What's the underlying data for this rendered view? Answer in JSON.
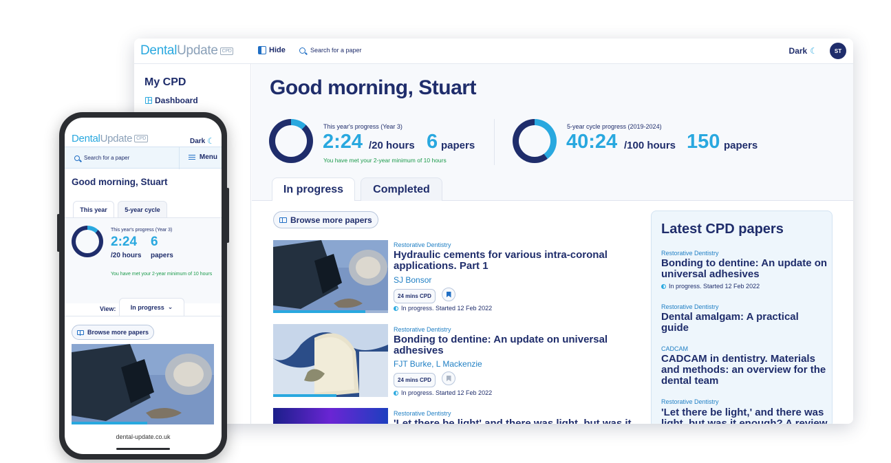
{
  "brand": {
    "word1": "Dental",
    "word2": "Update",
    "badge": "CPD"
  },
  "desktop": {
    "topbar": {
      "hide_label": "Hide",
      "search_label": "Search for a paper",
      "dark_label": "Dark",
      "avatar_initials": "ST"
    },
    "sidebar": {
      "title": "My CPD",
      "dashboard_label": "Dashboard"
    },
    "greeting": "Good morning, Stuart",
    "year_progress": {
      "label": "This year's progress (Year 3)",
      "time": "2:24",
      "hours_unit": "/20 hours",
      "papers_count": "6",
      "papers_unit": "papers",
      "note": "You have met your 2-year minimum of 10 hours",
      "fraction": 0.12
    },
    "cycle_progress": {
      "label": "5-year cycle progress (2019-2024)",
      "time": "40:24",
      "hours_unit": "/100 hours",
      "papers_count": "150",
      "papers_unit": "papers",
      "fraction": 0.4
    },
    "tabs": [
      {
        "label": "In progress"
      },
      {
        "label": "Completed"
      }
    ],
    "browse_label": "Browse more papers",
    "papers": [
      {
        "category": "Restorative Dentistry",
        "title": "Hydraulic cements for various intra-coronal applications. Part 1",
        "authors": "SJ Bonsor",
        "mins": "24 mins CPD",
        "status": "In progress. Started 12 Feb 2022",
        "bookmarked": true,
        "progress": 0.8
      },
      {
        "category": "Restorative Dentistry",
        "title": "Bonding to dentine: An update on universal adhesives",
        "authors": "FJT Burke, L Mackenzie",
        "mins": "24 mins CPD",
        "status": "In progress. Started 12 Feb 2022",
        "bookmarked": false,
        "progress": 0.55
      },
      {
        "category": "Restorative Dentistry",
        "title": "'Let there be light' and there was light, but was it"
      }
    ],
    "latest": {
      "heading": "Latest CPD papers",
      "items": [
        {
          "category": "Restorative Dentistry",
          "title": "Bonding to dentine: An update on universal adhesives",
          "status": "In progress. Started 12 Feb 2022"
        },
        {
          "category": "Restorative Dentistry",
          "title": "Dental amalgam: A practical guide"
        },
        {
          "category": "CADCAM",
          "title": "CADCAM in dentistry. Materials and methods: an overview for the dental team"
        },
        {
          "category": "Restorative Dentistry",
          "title": "'Let there be light,' and there was light, but was it enough? A review"
        }
      ]
    }
  },
  "mobile": {
    "dark_label": "Dark",
    "search_label": "Search for a paper",
    "menu_label": "Menu",
    "greeting": "Good morning, Stuart",
    "tabs": [
      {
        "label": "This year"
      },
      {
        "label": "5-year cycle"
      }
    ],
    "progress": {
      "label": "This year's progress (Year 3)",
      "time": "2:24",
      "hours_unit": "/20 hours",
      "papers_count": "6",
      "papers_unit": "papers",
      "note": "You have met your 2-year minimum of 10 hours",
      "fraction": 0.12
    },
    "view_label": "View:",
    "view_value": "In progress",
    "browse_label": "Browse more papers",
    "image_progress": 0.53,
    "url": "dental-update.co.uk"
  },
  "colors": {
    "primary": "#1f2d6b",
    "accent": "#29a8df",
    "success": "#1a9a4a"
  }
}
